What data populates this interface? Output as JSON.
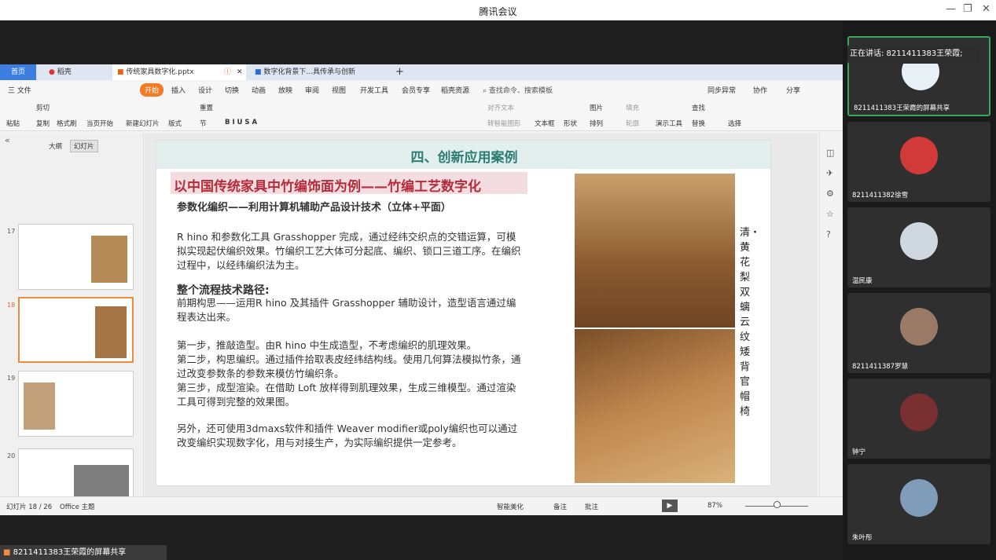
{
  "app_title": "腾讯会议",
  "speaking": "正在讲话: 8211411383王荣霞;",
  "share_label": "8211411383王荣霞的屏幕共享",
  "tabs": [
    "首页",
    "稻壳",
    "传统家具数字化.pptx",
    "数字化背景下...具传承与创新"
  ],
  "menu": [
    "三 文件",
    "开始",
    "插入",
    "设计",
    "切换",
    "动画",
    "放映",
    "审阅",
    "视图",
    "开发工具",
    "会员专享",
    "稻壳资源",
    "查找命令、搜索模板",
    "同步异常",
    "协作",
    "分享"
  ],
  "ribbon": {
    "paste": "粘贴",
    "cut": "剪切",
    "copy": "复制",
    "format": "格式刷",
    "from_current": "当页开始",
    "new_slide": "新建幻灯片",
    "layout": "版式",
    "section": "节",
    "reset": "重置",
    "textbox": "文本框",
    "shape": "形状",
    "arrange": "排列",
    "picture": "图片",
    "fill": "填充",
    "outline": "轮廓",
    "present": "演示工具",
    "find": "查找",
    "replace": "替换",
    "select": "选择",
    "align_text": "对齐文本",
    "convert": "转智能图形"
  },
  "panel_tabs": [
    "大纲",
    "幻灯片"
  ],
  "thumb_numbers": [
    "17",
    "18",
    "19",
    "20"
  ],
  "slide": {
    "header": "四、创新应用案例",
    "title": "以中国传统家具中竹编饰面为例——竹编工艺数字化",
    "subtitle": "参数化编织——利用计算机辅助产品设计技术（立体+平面）",
    "p1": "R hino 和参数化工具 Grasshopper 完成，通过经纬交织点的交错运算，可模拟实现起伏编织效果。竹编织工艺大体可分起底、编织、锁口三道工序。在编织过程中，以经纬编织法为主。",
    "h2": "整个流程技术路径:",
    "p2": "前期构思——运用R hino 及其插件 Grasshopper 辅助设计，造型语言通过编程表达出来。",
    "step1": "第一步，推敲造型。由R hino 中生成造型，不考虑编织的肌理效果。",
    "step2": "第二步，构思编织。通过插件拾取表皮经纬结构线。使用几何算法模拟竹条，通过改变参数条的参数来模仿竹编织条。",
    "step3": "第三步，成型渲染。在借助 Loft 放样得到肌理效果，生成三维模型。通过渲染工具可得到完整的效果图。",
    "p3": "另外，还可使用3dmaxs软件和插件 Weaver modifier或poly编织也可以通过改变编织实现数字化，用与对接生产，为实际编织提供一定参考。",
    "caption": "清・黄花梨双螭云纹矮背官帽椅"
  },
  "status": {
    "slide_no": "幻灯片 18 / 26",
    "theme": "Office 主题",
    "smart": "智能美化",
    "notes": "备注",
    "comment": "批注",
    "zoom": "87%"
  },
  "participants": [
    {
      "name": "8211411383王荣霞的屏幕共享",
      "color": "#e8f0f8"
    },
    {
      "name": "8211411382徐雪",
      "color": "#d23a3a"
    },
    {
      "name": "温民康",
      "color": "#cfd8e0"
    },
    {
      "name": "8211411387罗慧",
      "color": "#9a7a66"
    },
    {
      "name": "钟宁",
      "color": "#7a3030"
    },
    {
      "name": "朱叶彤",
      "color": "#7f9db8"
    }
  ]
}
